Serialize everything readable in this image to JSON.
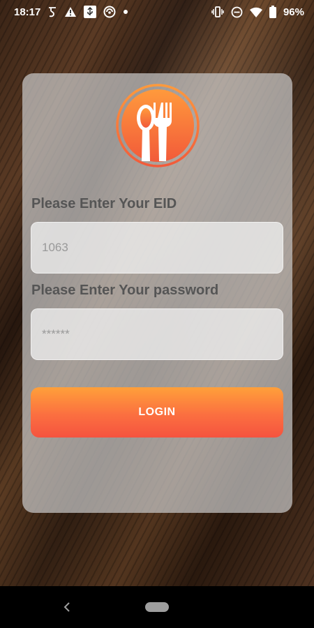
{
  "status_bar": {
    "time": "18:17",
    "battery_percent": "96%",
    "icons_left": [
      "hindi-glyph-icon",
      "warning-icon",
      "usb-icon",
      "circle-app-icon",
      "dot-icon"
    ],
    "icons_right": [
      "vibrate-icon",
      "do-not-disturb-icon",
      "wifi-icon",
      "battery-icon"
    ]
  },
  "logo": {
    "icon": "spoon-fork-icon",
    "gradient": [
      "#ff9a3c",
      "#f25a3a"
    ]
  },
  "form": {
    "eid_label": "Please Enter Your EID",
    "eid_placeholder": "1063",
    "password_label": "Please Enter Your password",
    "password_placeholder": "******",
    "login_label": "LOGIN"
  },
  "colors": {
    "accent_top": "#ffa03a",
    "accent_bottom": "#f5533f",
    "label_text": "#555555"
  },
  "nav_bar": {
    "back_icon": "back-chevron-icon",
    "home_icon": "home-pill-icon"
  }
}
